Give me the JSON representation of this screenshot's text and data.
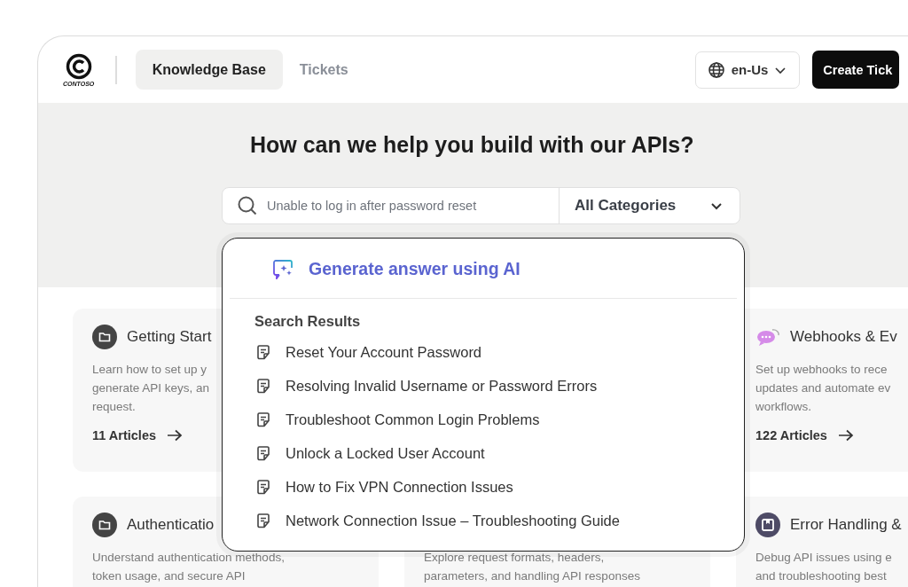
{
  "header": {
    "logo_text": "CONTOSO",
    "tabs": [
      {
        "label": "Knowledge Base",
        "selected": true
      },
      {
        "label": "Tickets",
        "selected": false
      }
    ],
    "language": "en-Us",
    "create_button": "Create Tick"
  },
  "hero": {
    "title": "How can we help you build with our APIs?",
    "search": {
      "placeholder": "Unable to log in after password reset"
    },
    "category": "All Categories"
  },
  "dropdown": {
    "ai_action": "Generate answer using AI",
    "section_title": "Search Results",
    "results": [
      "Reset Your Account Password",
      "Resolving Invalid Username or Password Errors",
      "Troubleshoot Common Login Problems",
      "Unlock a Locked User Account",
      "How to Fix VPN Connection Issues",
      "Network Connection Issue – Troubleshooting Guide"
    ]
  },
  "cards": [
    {
      "title": "Getting Start",
      "description": [
        "Learn how to set up y",
        "generate API keys, an",
        "request."
      ],
      "articles": "11 Articles"
    },
    {
      "title": "Webhooks & Ev",
      "description": [
        "Set up webhooks to rece",
        "updates and automate ev",
        "workflows."
      ],
      "articles": "122 Articles"
    },
    {
      "title": "Authenticatio",
      "description": [
        "Understand authentication methods,",
        "token usage, and secure API"
      ]
    },
    {
      "description": [
        "Explore request formats, headers,",
        "parameters, and handling API responses"
      ]
    },
    {
      "title": "Error Handling &",
      "description": [
        "Debug API issues using e",
        "and troubleshooting best"
      ]
    }
  ]
}
